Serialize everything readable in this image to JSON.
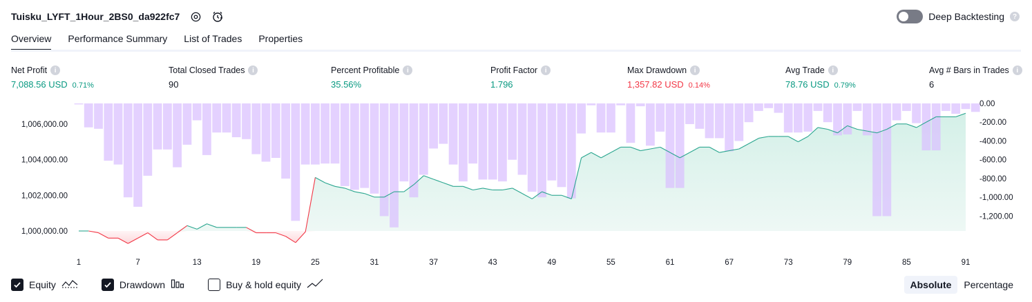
{
  "header": {
    "title": "Tuisku_LYFT_1Hour_2BS0_da922fc7",
    "icons": [
      "settings-icon",
      "alarm-clock-icon"
    ]
  },
  "deep_backtesting": {
    "label": "Deep Backtesting",
    "enabled": false,
    "help": "?"
  },
  "tabs": [
    {
      "label": "Overview",
      "active": true
    },
    {
      "label": "Performance Summary",
      "active": false
    },
    {
      "label": "List of Trades",
      "active": false
    },
    {
      "label": "Properties",
      "active": false
    }
  ],
  "info_glyph": "i",
  "metrics": [
    {
      "label": "Net Profit",
      "value": "7,088.56 USD",
      "pct": "0.71%",
      "tone": "green"
    },
    {
      "label": "Total Closed Trades",
      "value": "90",
      "pct": "",
      "tone": "dark"
    },
    {
      "label": "Percent Profitable",
      "value": "35.56%",
      "pct": "",
      "tone": "green"
    },
    {
      "label": "Profit Factor",
      "value": "1.796",
      "pct": "",
      "tone": "green"
    },
    {
      "label": "Max Drawdown",
      "value": "1,357.82 USD",
      "pct": "0.14%",
      "tone": "red"
    },
    {
      "label": "Avg Trade",
      "value": "78.76 USD",
      "pct": "0.79%",
      "tone": "green"
    },
    {
      "label": "Avg # Bars in Trades",
      "value": "6",
      "pct": "",
      "tone": "dark"
    }
  ],
  "colors": {
    "profit": "#089981",
    "loss": "#f23645",
    "drawdown_bar": "#d9bfff",
    "equity_line": "#2aa68f",
    "equity_fill": "#d4f0e8",
    "loss_fill": "#fcd9dc"
  },
  "legend": [
    {
      "label": "Equity",
      "checked": true,
      "icon": "equity-line-icon"
    },
    {
      "label": "Drawdown",
      "checked": true,
      "icon": "drawdown-bars-icon"
    },
    {
      "label": "Buy & hold equity",
      "checked": false,
      "icon": "buy-hold-line-icon"
    }
  ],
  "mode": {
    "options": [
      "Absolute",
      "Percentage"
    ],
    "selected": "Absolute"
  },
  "chart_data": {
    "type": "bar",
    "x_ticks": [
      "1",
      "7",
      "13",
      "19",
      "25",
      "31",
      "37",
      "43",
      "49",
      "55",
      "61",
      "67",
      "73",
      "79",
      "85",
      "91"
    ],
    "x_range": [
      1,
      91
    ],
    "left_axis": {
      "ticks": [
        "1,006,000.00",
        "1,004,000.00",
        "1,002,000.00",
        "1,000,000.00"
      ],
      "range": [
        999500,
        1007150
      ]
    },
    "right_axis": {
      "ticks": [
        "0.00",
        "-200.00",
        "-400.00",
        "-600.00",
        "-800.00",
        "-1,000.00",
        "-1,200.00"
      ],
      "range": [
        -1357.82,
        0
      ]
    },
    "grid": false,
    "series": [
      {
        "name": "Equity",
        "type": "area",
        "baseline": 1000000,
        "values": [
          1000000,
          1000000,
          999900,
          999600,
          999600,
          999300,
          999600,
          999900,
          999500,
          999500,
          999900,
          1000300,
          1000100,
          1000400,
          1000200,
          1000200,
          1000200,
          1000200,
          999900,
          999900,
          999900,
          999700,
          999350,
          999950,
          1003000,
          1002700,
          1002500,
          1002400,
          1002200,
          1002100,
          1001900,
          1001900,
          1002200,
          1002200,
          1002600,
          1003100,
          1002900,
          1002700,
          1002500,
          1002500,
          1002300,
          1002400,
          1002300,
          1002300,
          1002400,
          1002100,
          1001800,
          1002200,
          1002000,
          1002000,
          1001800,
          1004100,
          1004400,
          1004100,
          1004400,
          1004700,
          1004700,
          1004500,
          1004600,
          1004700,
          1004400,
          1004100,
          1004400,
          1004700,
          1004700,
          1004400,
          1004500,
          1004600,
          1004900,
          1005200,
          1005300,
          1005300,
          1005300,
          1005000,
          1005300,
          1005800,
          1005700,
          1005500,
          1005900,
          1005700,
          1005600,
          1005500,
          1005700,
          1006000,
          1006000,
          1005800,
          1006100,
          1006400,
          1006400,
          1006400,
          1006600
        ]
      },
      {
        "name": "Drawdown",
        "type": "bar",
        "values": [
          -10,
          -255,
          -270,
          -610,
          -650,
          -1000,
          -1100,
          -770,
          -490,
          -490,
          -680,
          -440,
          -180,
          -550,
          -310,
          -310,
          -360,
          -380,
          -540,
          -620,
          -580,
          -800,
          -1250,
          -650,
          -650,
          -640,
          -640,
          -880,
          -920,
          -900,
          -960,
          -1200,
          -1320,
          -830,
          -1000,
          -760,
          -480,
          -430,
          -650,
          -830,
          -640,
          -810,
          -810,
          -830,
          -600,
          -760,
          -940,
          -1000,
          -820,
          -890,
          -1010,
          -320,
          -20,
          -310,
          -310,
          -20,
          -420,
          -30,
          -450,
          -300,
          -900,
          -900,
          -220,
          -270,
          -370,
          -370,
          -510,
          -400,
          -200,
          -80,
          -50,
          -100,
          -310,
          -310,
          -300,
          -80,
          -200,
          -340,
          -330,
          -80,
          -340,
          -1200,
          -1200,
          -180,
          -80,
          -210,
          -500,
          -500,
          -80,
          -110,
          -60,
          -90
        ]
      }
    ]
  }
}
